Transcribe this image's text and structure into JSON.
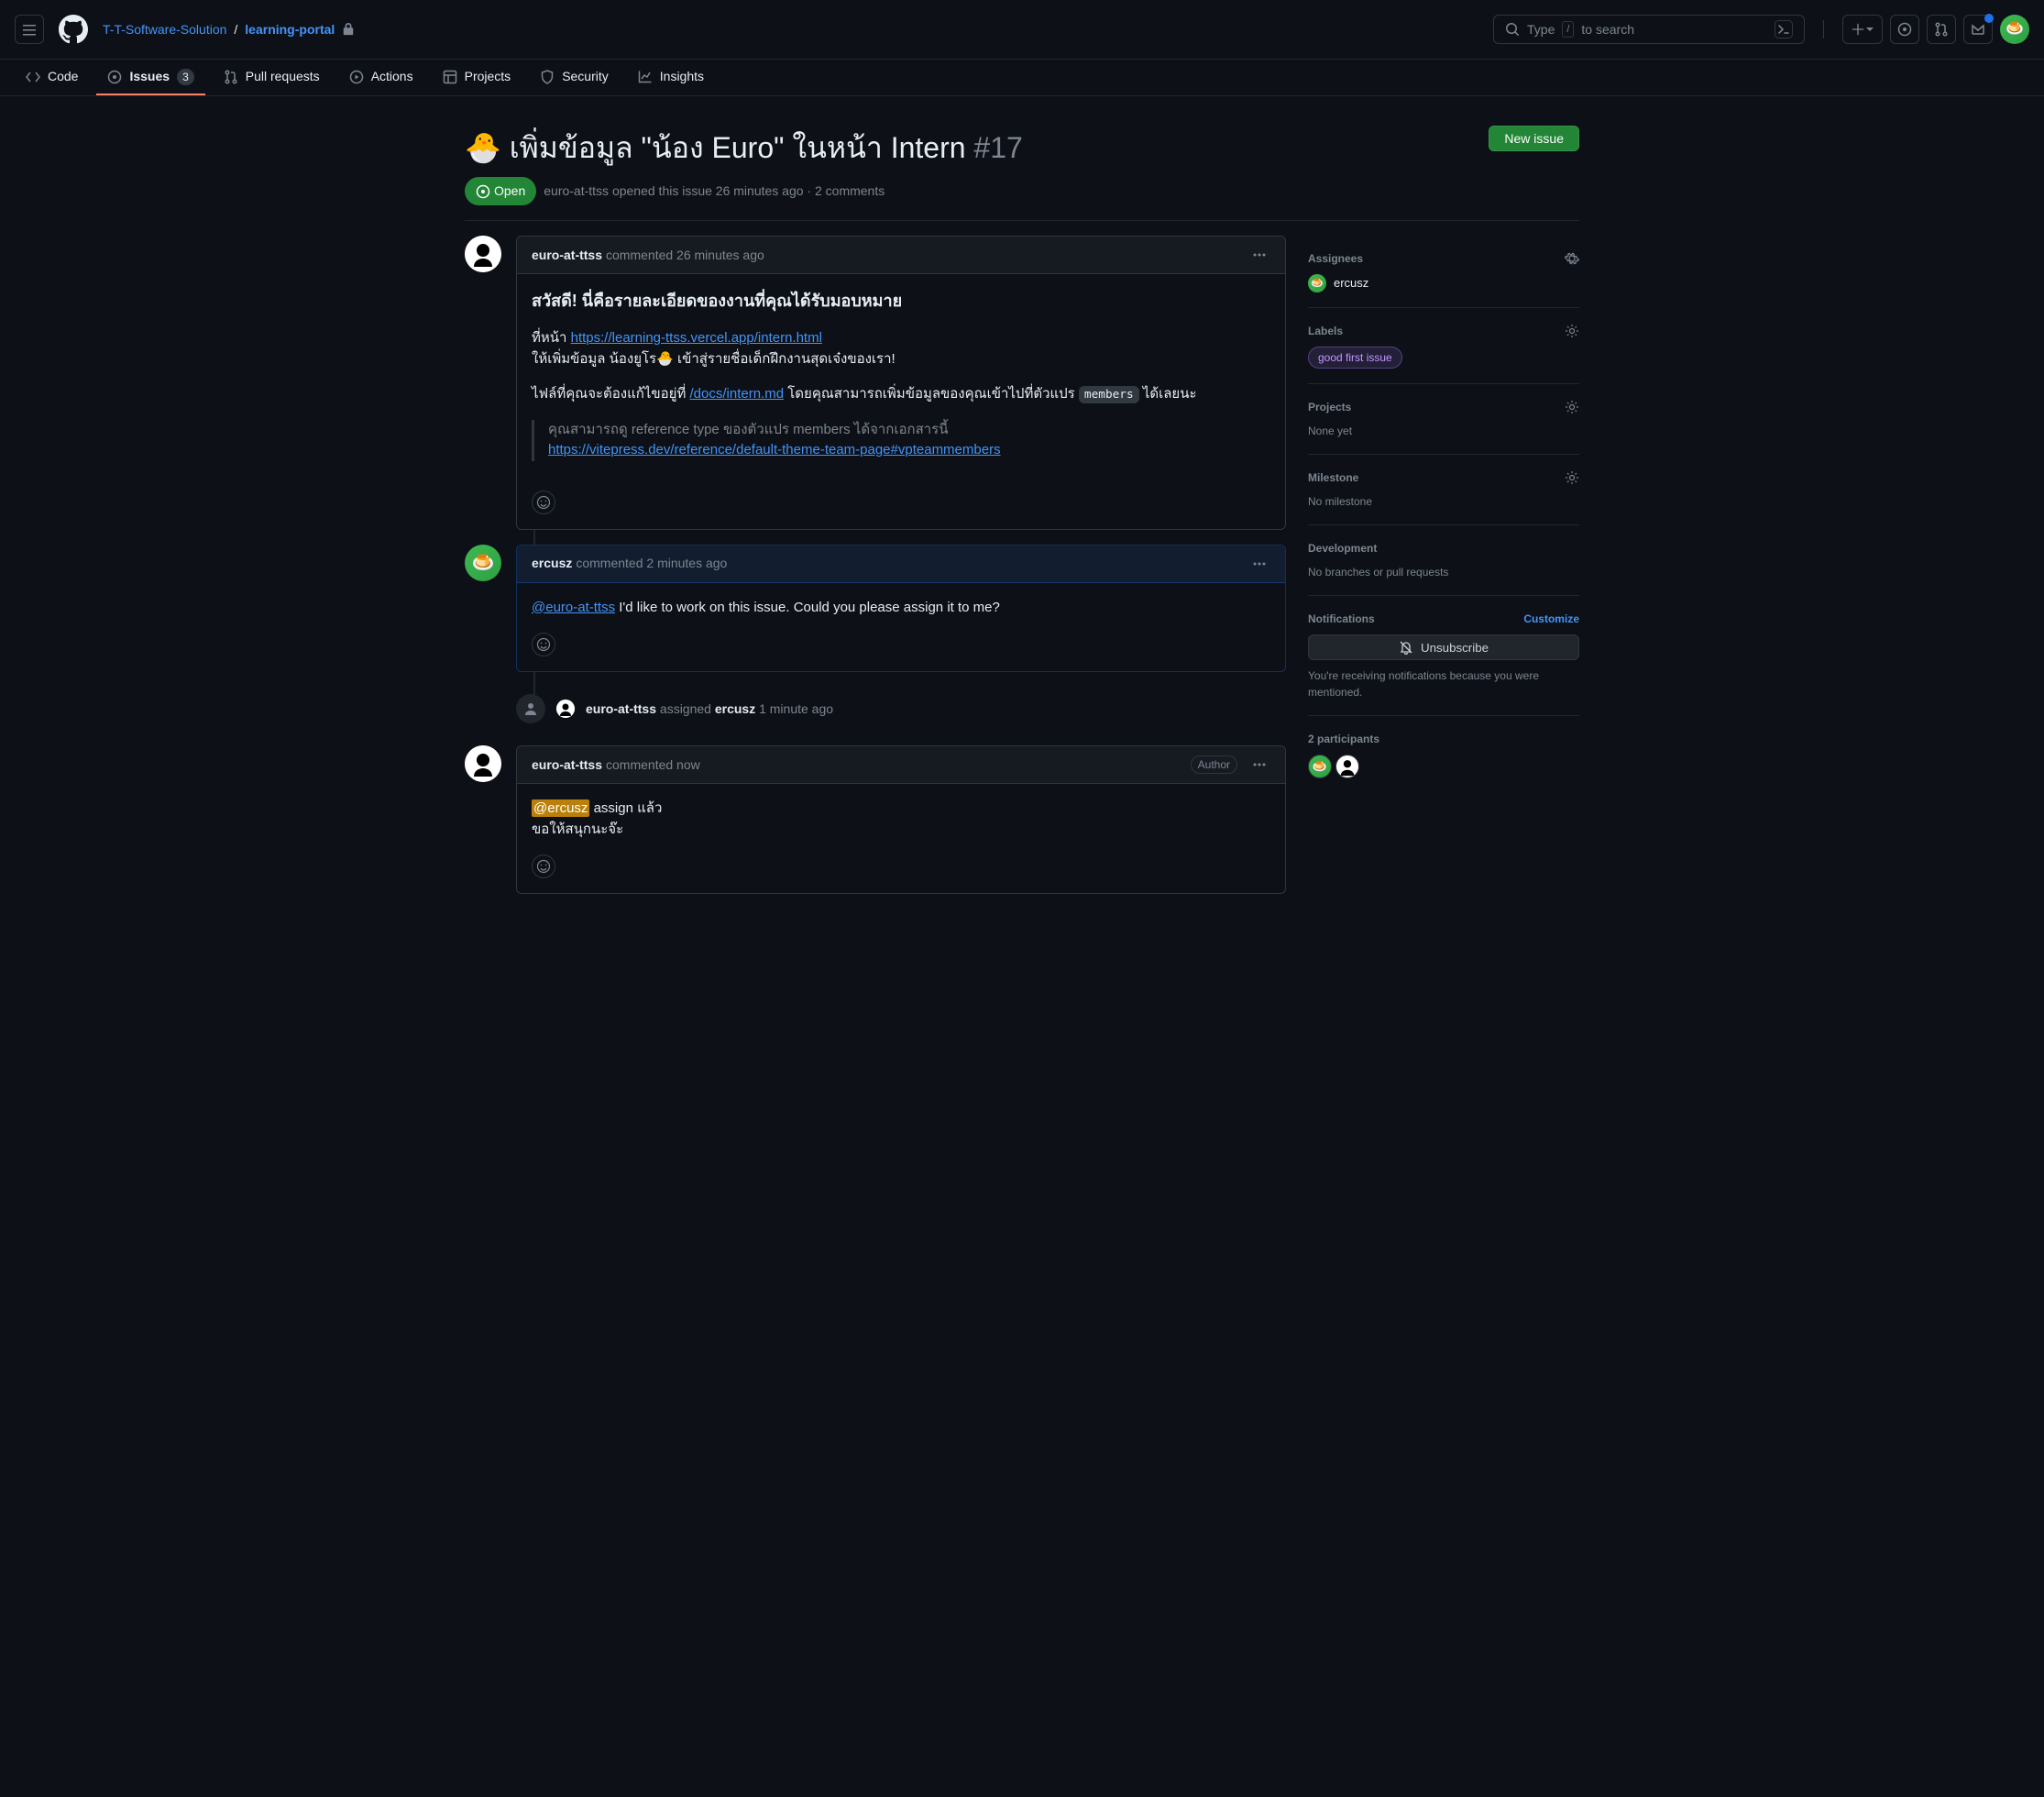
{
  "header": {
    "org": "T-T-Software-Solution",
    "repo": "learning-portal",
    "search_prefix": "Type",
    "search_kbd": "/",
    "search_suffix": "to search"
  },
  "nav": {
    "code": "Code",
    "issues": "Issues",
    "issues_count": "3",
    "pullrequests": "Pull requests",
    "actions": "Actions",
    "projects": "Projects",
    "security": "Security",
    "insights": "Insights"
  },
  "issue": {
    "emoji": "🐣",
    "title": "เพิ่มข้อมูล \"น้อง Euro\" ในหน้า Intern",
    "number": "#17",
    "new_issue": "New issue",
    "state": "Open",
    "author": "euro-at-ttss",
    "opened_text": "opened this issue 26 minutes ago · 2 comments"
  },
  "comments": [
    {
      "author": "euro-at-ttss",
      "meta": "commented 26 minutes ago",
      "heading": "สวัสดี! นี่คือรายละเอียดของงานที่คุณได้รับมอบหมาย",
      "p1_pre": "ที่หน้า ",
      "p1_link": "https://learning-ttss.vercel.app/intern.html",
      "p2": "ให้เพิ่มข้อมูล น้องยูโร🐣 เข้าสู่รายชื่อเด็กฝึกงานสุดเจ๋งของเรา!",
      "p3_pre": "ไฟล์ที่คุณจะต้องแก้ไขอยู่ที่ ",
      "p3_link": "/docs/intern.md",
      "p3_mid": " โดยคุณสามารถเพิ่มข้อมูลของคุณเข้าไปที่ตัวแปร ",
      "p3_code": "members",
      "p3_post": " ได้เลยนะ",
      "bq_text": "คุณสามารถดู reference type ของตัวแปร members ได้จากเอกสารนี้",
      "bq_link": "https://vitepress.dev/reference/default-theme-team-page#vpteammembers"
    },
    {
      "author": "ercusz",
      "meta": "commented 2 minutes ago",
      "mention": "@euro-at-ttss",
      "text": " I'd like to work on this issue. Could you please assign it to me?"
    },
    {
      "author": "euro-at-ttss",
      "meta": "commented now",
      "badge": "Author",
      "mention": "@ercusz",
      "text1": " assign แล้ว",
      "text2": "ขอให้สนุกนะจ๊ะ"
    }
  ],
  "event": {
    "actor": "euro-at-ttss",
    "verb": "assigned",
    "target": "ercusz",
    "time": "1 minute ago"
  },
  "sidebar": {
    "assignees_label": "Assignees",
    "assignee": "ercusz",
    "labels_label": "Labels",
    "label_value": "good first issue",
    "projects_label": "Projects",
    "projects_none": "None yet",
    "milestone_label": "Milestone",
    "milestone_none": "No milestone",
    "development_label": "Development",
    "development_none": "No branches or pull requests",
    "notifications_label": "Notifications",
    "customize": "Customize",
    "unsubscribe": "Unsubscribe",
    "notifications_hint": "You're receiving notifications because you were mentioned.",
    "participants_label": "2 participants"
  }
}
